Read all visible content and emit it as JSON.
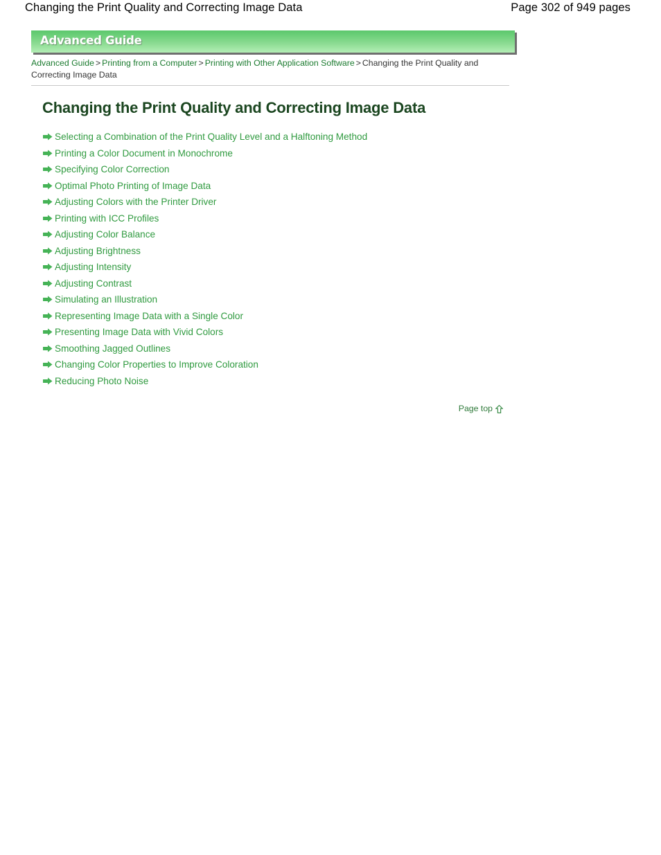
{
  "doc_header": {
    "title": "Changing the Print Quality and Correcting Image Data",
    "page_label": "Page 302 of 949 pages"
  },
  "banner": {
    "label": "Advanced Guide",
    "gradient_top": "#5cc76c",
    "gradient_bottom": "#b4eeb6",
    "shadow_color": "#6f6f6f"
  },
  "breadcrumb": {
    "items": [
      {
        "label": "Advanced Guide",
        "is_link": true
      },
      {
        "label": "Printing from a Computer",
        "is_link": true
      },
      {
        "label": "Printing with Other Application Software",
        "is_link": true
      },
      {
        "label": "Changing the Print Quality and Correcting Image Data",
        "is_link": false
      }
    ],
    "separator": ">"
  },
  "page_title": "Changing the Print Quality and Correcting Image Data",
  "link_list": {
    "icon": "arrow-right-icon",
    "link_color": "#2f9a3f",
    "items": [
      "Selecting a Combination of the Print Quality Level and a Halftoning Method",
      "Printing a Color Document in Monochrome",
      "Specifying Color Correction",
      "Optimal Photo Printing of Image Data",
      "Adjusting Colors with the Printer Driver",
      "Printing with ICC Profiles",
      "Adjusting Color Balance",
      "Adjusting Brightness",
      "Adjusting Intensity",
      "Adjusting Contrast",
      "Simulating an Illustration",
      "Representing Image Data with a Single Color",
      "Presenting Image Data with Vivid Colors",
      "Smoothing Jagged Outlines",
      "Changing Color Properties to Improve Coloration",
      "Reducing Photo Noise"
    ]
  },
  "page_top": {
    "label": "Page top",
    "icon": "arrow-up-icon"
  }
}
